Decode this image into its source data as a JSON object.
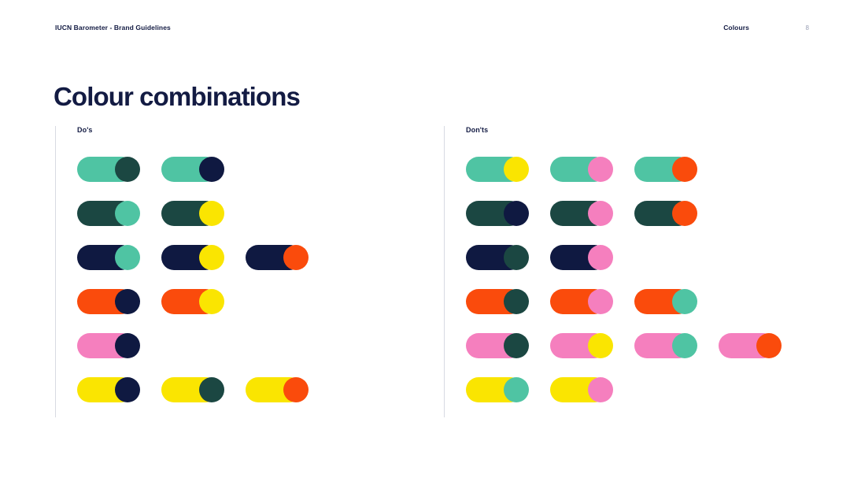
{
  "header": {
    "document_title": "IUCN Barometer - Brand Guidelines",
    "section": "Colours",
    "page_number": "8"
  },
  "title": "Colour combinations",
  "palette": {
    "mint": "#4FC4A3",
    "dark_green": "#1B4742",
    "navy": "#0F1941",
    "orange": "#FA4B0C",
    "pink": "#F57FBE",
    "yellow": "#FAE501",
    "rule": "#D8DAE2",
    "text": "#131B43"
  },
  "columns": [
    {
      "label": "Do's",
      "rows": [
        [
          {
            "pill": "#4FC4A3",
            "dot": "#1B4742"
          },
          {
            "pill": "#4FC4A3",
            "dot": "#0F1941"
          }
        ],
        [
          {
            "pill": "#1B4742",
            "dot": "#4FC4A3"
          },
          {
            "pill": "#1B4742",
            "dot": "#FAE501"
          }
        ],
        [
          {
            "pill": "#0F1941",
            "dot": "#4FC4A3"
          },
          {
            "pill": "#0F1941",
            "dot": "#FAE501"
          },
          {
            "pill": "#0F1941",
            "dot": "#FA4B0C"
          }
        ],
        [
          {
            "pill": "#FA4B0C",
            "dot": "#0F1941"
          },
          {
            "pill": "#FA4B0C",
            "dot": "#FAE501"
          }
        ],
        [
          {
            "pill": "#F57FBE",
            "dot": "#0F1941"
          }
        ],
        [
          {
            "pill": "#FAE501",
            "dot": "#0F1941"
          },
          {
            "pill": "#FAE501",
            "dot": "#1B4742"
          },
          {
            "pill": "#FAE501",
            "dot": "#FA4B0C"
          }
        ]
      ]
    },
    {
      "label": "Don'ts",
      "rows": [
        [
          {
            "pill": "#4FC4A3",
            "dot": "#FAE501"
          },
          {
            "pill": "#4FC4A3",
            "dot": "#F57FBE"
          },
          {
            "pill": "#4FC4A3",
            "dot": "#FA4B0C"
          }
        ],
        [
          {
            "pill": "#1B4742",
            "dot": "#0F1941"
          },
          {
            "pill": "#1B4742",
            "dot": "#F57FBE"
          },
          {
            "pill": "#1B4742",
            "dot": "#FA4B0C"
          }
        ],
        [
          {
            "pill": "#0F1941",
            "dot": "#1B4742"
          },
          {
            "pill": "#0F1941",
            "dot": "#F57FBE"
          }
        ],
        [
          {
            "pill": "#FA4B0C",
            "dot": "#1B4742"
          },
          {
            "pill": "#FA4B0C",
            "dot": "#F57FBE"
          },
          {
            "pill": "#FA4B0C",
            "dot": "#4FC4A3"
          }
        ],
        [
          {
            "pill": "#F57FBE",
            "dot": "#1B4742"
          },
          {
            "pill": "#F57FBE",
            "dot": "#FAE501"
          },
          {
            "pill": "#F57FBE",
            "dot": "#4FC4A3"
          },
          {
            "pill": "#F57FBE",
            "dot": "#FA4B0C"
          }
        ],
        [
          {
            "pill": "#FAE501",
            "dot": "#4FC4A3"
          },
          {
            "pill": "#FAE501",
            "dot": "#F57FBE"
          }
        ]
      ]
    }
  ]
}
